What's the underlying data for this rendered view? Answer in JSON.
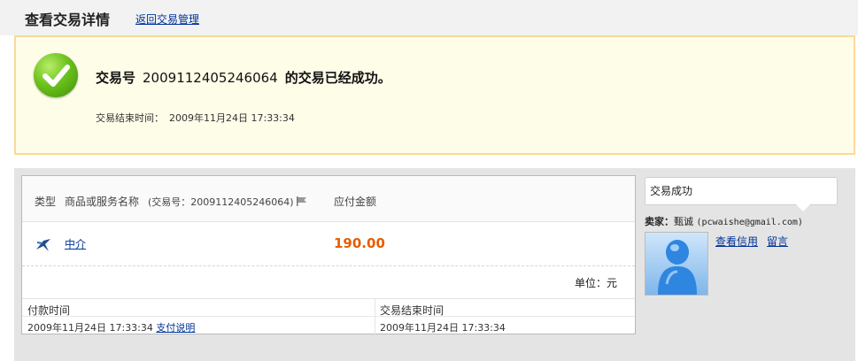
{
  "header": {
    "title": "查看交易详情",
    "back_link": "返回交易管理"
  },
  "status": {
    "prefix": "交易号",
    "trade_no": "2009112405246064",
    "suffix": "的交易已经成功。",
    "end_label": "交易结束时间：",
    "end_time": "2009年11月24日 17:33:34"
  },
  "table": {
    "col_type": "类型",
    "col_name": "商品或服务名称",
    "col_trade_ref": "(交易号：2009112405246064)",
    "col_amount": "应付金额",
    "item_name": "中介",
    "item_amount": "190.00",
    "unit": "单位：元"
  },
  "times": {
    "pay_time_label": "付款时间",
    "pay_time": "2009年11月24日 17:33:34",
    "pay_note_link": "支付说明",
    "end_time_label": "交易结束时间",
    "end_time": "2009年11月24日 17:33:34"
  },
  "side": {
    "status": "交易成功",
    "seller_label": "卖家：",
    "seller_name": "甄诚",
    "seller_email": "(pcwaishe@gmail.com)",
    "credit_link": "查看信用",
    "message_link": "留言"
  }
}
